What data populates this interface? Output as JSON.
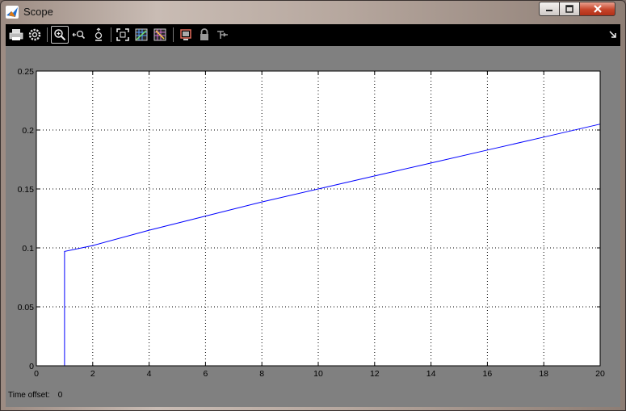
{
  "window": {
    "title": "Scope"
  },
  "toolbar": {
    "buttons": [
      {
        "name": "print-icon"
      },
      {
        "name": "parameters-icon"
      },
      {
        "name": "zoom-in-icon",
        "active": true
      },
      {
        "name": "zoom-x-icon"
      },
      {
        "name": "zoom-y-icon"
      },
      {
        "name": "autoscale-icon"
      },
      {
        "name": "save-axes-settings-icon"
      },
      {
        "name": "restore-axes-settings-icon"
      },
      {
        "name": "floating-scope-icon"
      },
      {
        "name": "lock-axes-icon"
      },
      {
        "name": "signal-selection-icon"
      }
    ]
  },
  "footer": {
    "time_offset_label": "Time offset:",
    "time_offset_value": "0"
  },
  "chart_data": {
    "type": "line",
    "xlim": [
      0,
      20
    ],
    "ylim": [
      0,
      0.25
    ],
    "xticks": [
      0,
      2,
      4,
      6,
      8,
      10,
      12,
      14,
      16,
      18,
      20
    ],
    "yticks": [
      0,
      0.05,
      0.1,
      0.15,
      0.2,
      0.25
    ],
    "xtick_labels": [
      "0",
      "2",
      "4",
      "6",
      "8",
      "10",
      "12",
      "14",
      "16",
      "18",
      "20"
    ],
    "ytick_labels": [
      "0",
      "0.05",
      "0.1",
      "0.15",
      "0.2",
      "0.25"
    ],
    "grid": true,
    "grid_style": "dotted",
    "colors": {
      "line": "#0000ff",
      "axes_bg": "#ffffff",
      "frame_bg": "#808080"
    },
    "series": [
      {
        "x": [
          0,
          1,
          1,
          2,
          4,
          6,
          8,
          10,
          12,
          14,
          16,
          18,
          20
        ],
        "y": [
          0,
          0,
          0.097,
          0.102,
          0.115,
          0.127,
          0.139,
          0.15,
          0.161,
          0.172,
          0.183,
          0.194,
          0.205
        ]
      }
    ]
  }
}
